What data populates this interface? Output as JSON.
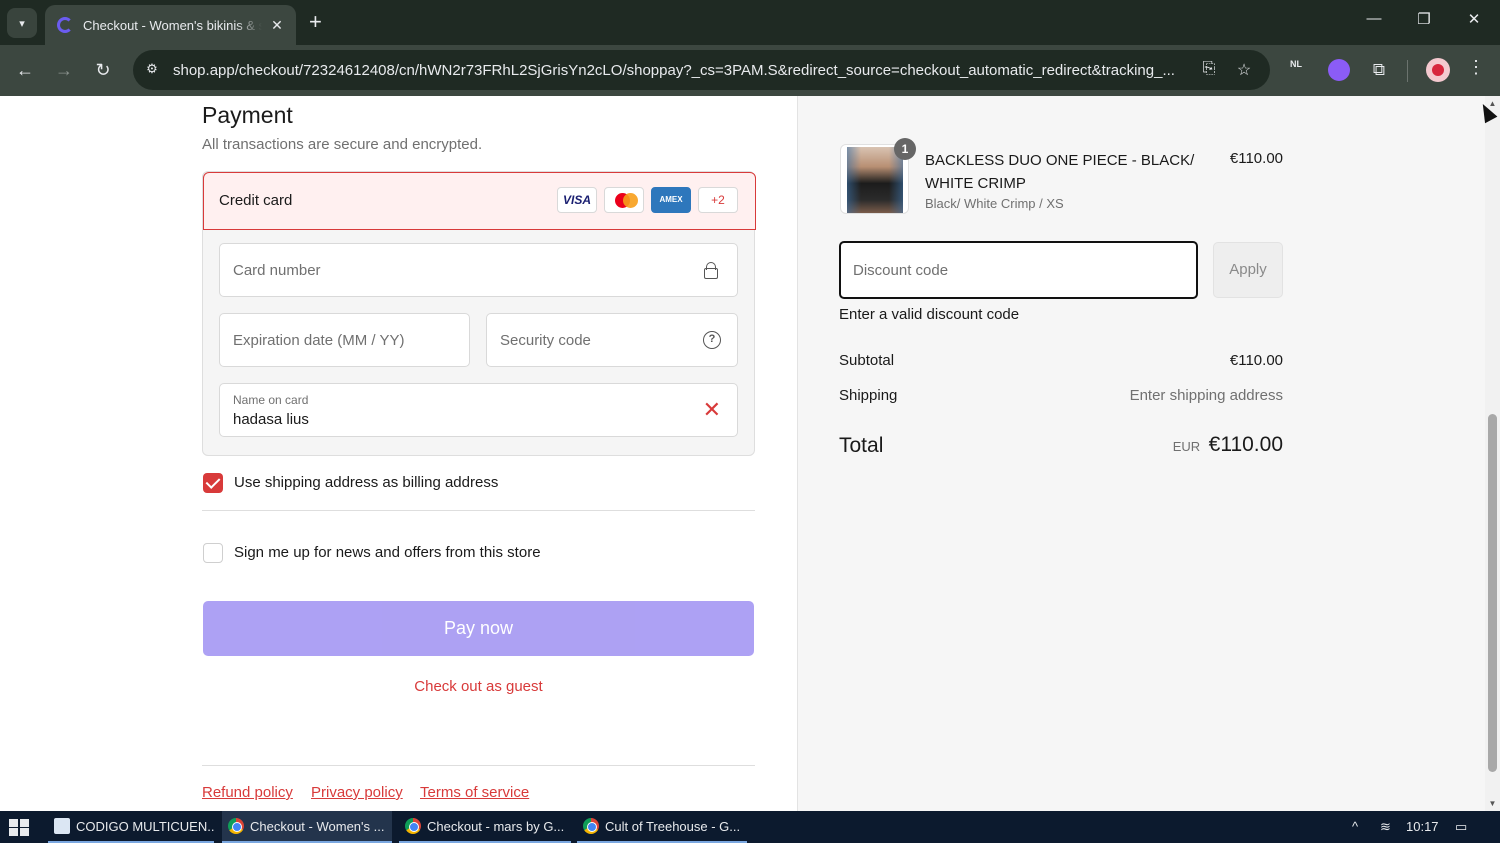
{
  "browser": {
    "tab_title": "Checkout - Women's bikinis & swimwear",
    "url": "shop.app/checkout/72324612408/cn/hWN2r73FRhL2SjGrisYn2cLO/shoppay?_cs=3PAM.S&redirect_source=checkout_automatic_redirect&tracking_...",
    "icons": {
      "tab_list": "▾",
      "tab_close": "✕",
      "new_tab": "+",
      "minimize": "—",
      "restore": "❐",
      "close": "✕",
      "back": "←",
      "forward": "→",
      "reload": "↻",
      "site_info": "⚙",
      "translate": "⎘",
      "bookmark": "☆",
      "extensions": "⧉",
      "menu": "⋮"
    },
    "extension_nl": "NL"
  },
  "payment": {
    "title": "Payment",
    "subtitle": "All transactions are secure and encrypted.",
    "method_label": "Credit card",
    "card_logos": {
      "visa": "VISA",
      "amex": "AMEX",
      "more": "+2"
    },
    "card_number_placeholder": "Card number",
    "expiration_placeholder": "Expiration date (MM / YY)",
    "security_placeholder": "Security code",
    "security_help": "?",
    "name_label": "Name on card",
    "name_value": "hadasa lius",
    "clear_icon": "✕",
    "billing_checkbox_label": "Use shipping address as billing address",
    "billing_checked": true,
    "news_checkbox_label": "Sign me up for news and offers from this store",
    "news_checked": false,
    "pay_button": "Pay now",
    "guest_link": "Check out as guest"
  },
  "footer": {
    "refund": "Refund policy",
    "privacy": "Privacy policy",
    "terms": "Terms of service"
  },
  "order": {
    "product_name": "BACKLESS DUO ONE PIECE - BLACK/ WHITE CRIMP",
    "product_variant": "Black/ White Crimp / XS",
    "product_price": "€110.00",
    "quantity": "1",
    "discount_placeholder": "Discount code",
    "apply_button": "Apply",
    "discount_error": "Enter a valid discount code",
    "subtotal_label": "Subtotal",
    "subtotal_value": "€110.00",
    "shipping_label": "Shipping",
    "shipping_value": "Enter shipping address",
    "total_label": "Total",
    "total_currency": "EUR",
    "total_value": "€110.00"
  },
  "taskbar": {
    "items": [
      "CODIGO MULTICUEN...",
      "Checkout - Women's ...",
      "Checkout - mars by G...",
      "Cult of Treehouse - G..."
    ],
    "time": "10:17",
    "tray_up": "^",
    "notification": "▭"
  },
  "colors": {
    "accent": "#d83a3a",
    "pay_button": "#a99cf3",
    "chrome_dark": "#1f2a23",
    "chrome_toolbar": "#3c4740"
  }
}
